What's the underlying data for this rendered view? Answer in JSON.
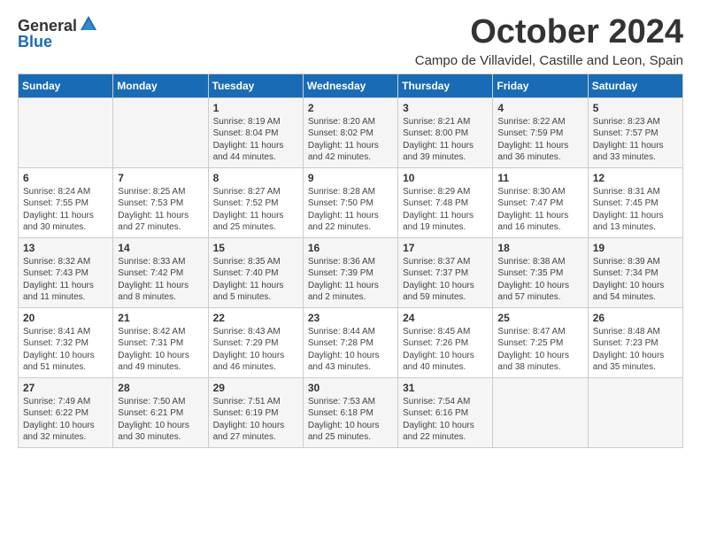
{
  "logo": {
    "general": "General",
    "blue": "Blue"
  },
  "title": "October 2024",
  "location": "Campo de Villavidel, Castille and Leon, Spain",
  "headers": [
    "Sunday",
    "Monday",
    "Tuesday",
    "Wednesday",
    "Thursday",
    "Friday",
    "Saturday"
  ],
  "weeks": [
    [
      {
        "day": "",
        "text": ""
      },
      {
        "day": "",
        "text": ""
      },
      {
        "day": "1",
        "text": "Sunrise: 8:19 AM\nSunset: 8:04 PM\nDaylight: 11 hours and 44 minutes."
      },
      {
        "day": "2",
        "text": "Sunrise: 8:20 AM\nSunset: 8:02 PM\nDaylight: 11 hours and 42 minutes."
      },
      {
        "day": "3",
        "text": "Sunrise: 8:21 AM\nSunset: 8:00 PM\nDaylight: 11 hours and 39 minutes."
      },
      {
        "day": "4",
        "text": "Sunrise: 8:22 AM\nSunset: 7:59 PM\nDaylight: 11 hours and 36 minutes."
      },
      {
        "day": "5",
        "text": "Sunrise: 8:23 AM\nSunset: 7:57 PM\nDaylight: 11 hours and 33 minutes."
      }
    ],
    [
      {
        "day": "6",
        "text": "Sunrise: 8:24 AM\nSunset: 7:55 PM\nDaylight: 11 hours and 30 minutes."
      },
      {
        "day": "7",
        "text": "Sunrise: 8:25 AM\nSunset: 7:53 PM\nDaylight: 11 hours and 27 minutes."
      },
      {
        "day": "8",
        "text": "Sunrise: 8:27 AM\nSunset: 7:52 PM\nDaylight: 11 hours and 25 minutes."
      },
      {
        "day": "9",
        "text": "Sunrise: 8:28 AM\nSunset: 7:50 PM\nDaylight: 11 hours and 22 minutes."
      },
      {
        "day": "10",
        "text": "Sunrise: 8:29 AM\nSunset: 7:48 PM\nDaylight: 11 hours and 19 minutes."
      },
      {
        "day": "11",
        "text": "Sunrise: 8:30 AM\nSunset: 7:47 PM\nDaylight: 11 hours and 16 minutes."
      },
      {
        "day": "12",
        "text": "Sunrise: 8:31 AM\nSunset: 7:45 PM\nDaylight: 11 hours and 13 minutes."
      }
    ],
    [
      {
        "day": "13",
        "text": "Sunrise: 8:32 AM\nSunset: 7:43 PM\nDaylight: 11 hours and 11 minutes."
      },
      {
        "day": "14",
        "text": "Sunrise: 8:33 AM\nSunset: 7:42 PM\nDaylight: 11 hours and 8 minutes."
      },
      {
        "day": "15",
        "text": "Sunrise: 8:35 AM\nSunset: 7:40 PM\nDaylight: 11 hours and 5 minutes."
      },
      {
        "day": "16",
        "text": "Sunrise: 8:36 AM\nSunset: 7:39 PM\nDaylight: 11 hours and 2 minutes."
      },
      {
        "day": "17",
        "text": "Sunrise: 8:37 AM\nSunset: 7:37 PM\nDaylight: 10 hours and 59 minutes."
      },
      {
        "day": "18",
        "text": "Sunrise: 8:38 AM\nSunset: 7:35 PM\nDaylight: 10 hours and 57 minutes."
      },
      {
        "day": "19",
        "text": "Sunrise: 8:39 AM\nSunset: 7:34 PM\nDaylight: 10 hours and 54 minutes."
      }
    ],
    [
      {
        "day": "20",
        "text": "Sunrise: 8:41 AM\nSunset: 7:32 PM\nDaylight: 10 hours and 51 minutes."
      },
      {
        "day": "21",
        "text": "Sunrise: 8:42 AM\nSunset: 7:31 PM\nDaylight: 10 hours and 49 minutes."
      },
      {
        "day": "22",
        "text": "Sunrise: 8:43 AM\nSunset: 7:29 PM\nDaylight: 10 hours and 46 minutes."
      },
      {
        "day": "23",
        "text": "Sunrise: 8:44 AM\nSunset: 7:28 PM\nDaylight: 10 hours and 43 minutes."
      },
      {
        "day": "24",
        "text": "Sunrise: 8:45 AM\nSunset: 7:26 PM\nDaylight: 10 hours and 40 minutes."
      },
      {
        "day": "25",
        "text": "Sunrise: 8:47 AM\nSunset: 7:25 PM\nDaylight: 10 hours and 38 minutes."
      },
      {
        "day": "26",
        "text": "Sunrise: 8:48 AM\nSunset: 7:23 PM\nDaylight: 10 hours and 35 minutes."
      }
    ],
    [
      {
        "day": "27",
        "text": "Sunrise: 7:49 AM\nSunset: 6:22 PM\nDaylight: 10 hours and 32 minutes."
      },
      {
        "day": "28",
        "text": "Sunrise: 7:50 AM\nSunset: 6:21 PM\nDaylight: 10 hours and 30 minutes."
      },
      {
        "day": "29",
        "text": "Sunrise: 7:51 AM\nSunset: 6:19 PM\nDaylight: 10 hours and 27 minutes."
      },
      {
        "day": "30",
        "text": "Sunrise: 7:53 AM\nSunset: 6:18 PM\nDaylight: 10 hours and 25 minutes."
      },
      {
        "day": "31",
        "text": "Sunrise: 7:54 AM\nSunset: 6:16 PM\nDaylight: 10 hours and 22 minutes."
      },
      {
        "day": "",
        "text": ""
      },
      {
        "day": "",
        "text": ""
      }
    ]
  ]
}
